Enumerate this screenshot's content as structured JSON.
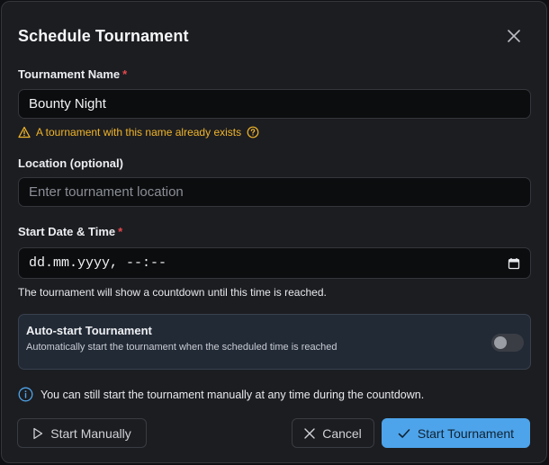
{
  "dialog": {
    "title": "Schedule Tournament",
    "close_icon": "close-icon"
  },
  "name_field": {
    "label": "Tournament Name",
    "required_mark": "*",
    "value": "Bounty Night"
  },
  "warning": {
    "icon": "warning-icon",
    "text": "A tournament with this name already exists",
    "help_icon": "help-circle-icon",
    "color": "#f0b429"
  },
  "location_field": {
    "label": "Location (optional)",
    "placeholder": "Enter tournament location"
  },
  "datetime_field": {
    "label": "Start Date & Time",
    "required_mark": "*",
    "value": "dd.mm.yyyy, --:--",
    "icon": "calendar-icon",
    "help_text": "The tournament will show a countdown until this time is reached."
  },
  "autostart": {
    "title": "Auto-start Tournament",
    "description": "Automatically start the tournament when the scheduled time is reached",
    "enabled": false
  },
  "info": {
    "icon": "info-icon",
    "text": "You can still start the tournament manually at any time during the countdown."
  },
  "buttons": {
    "start_manually": "Start Manually",
    "cancel": "Cancel",
    "start_tournament": "Start Tournament"
  },
  "colors": {
    "accent": "#4ea4ea",
    "required": "#e5484d",
    "background": "#1c1d21"
  }
}
